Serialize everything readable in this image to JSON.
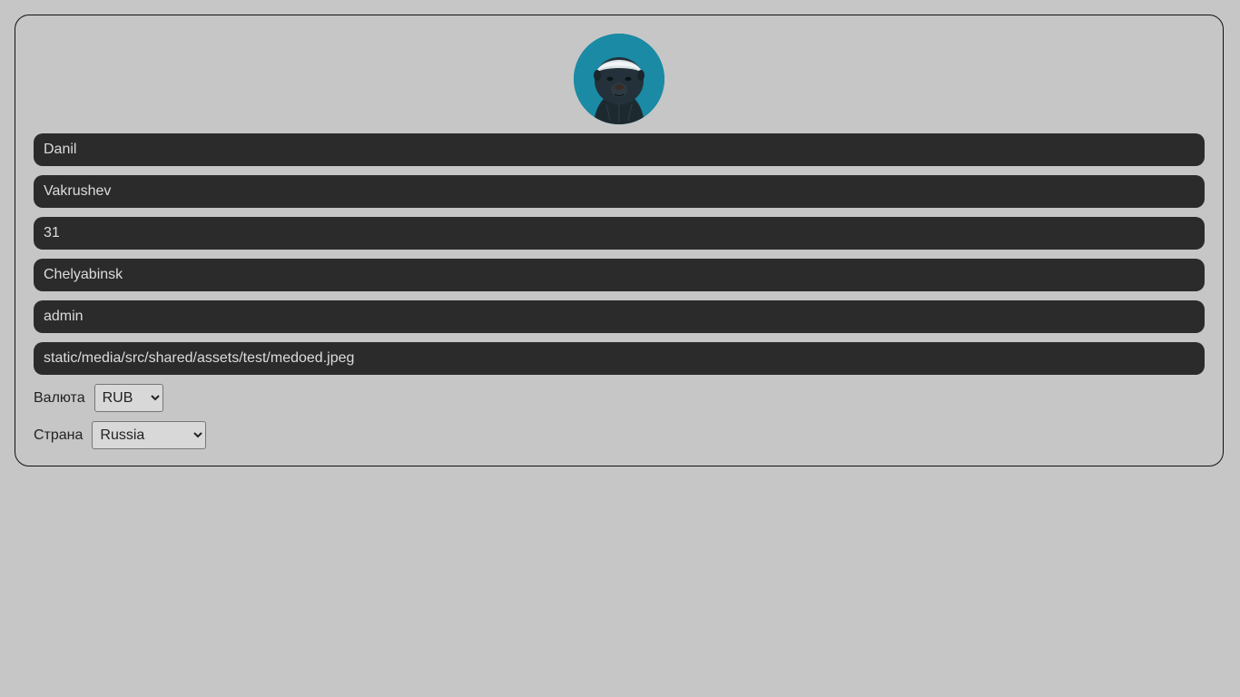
{
  "profile": {
    "avatar_icon": "honey-badger-avatar",
    "fields": [
      {
        "name": "first-name-field",
        "value": "Danil"
      },
      {
        "name": "last-name-field",
        "value": "Vakrushev"
      },
      {
        "name": "age-field",
        "value": "31"
      },
      {
        "name": "city-field",
        "value": "Chelyabinsk"
      },
      {
        "name": "username-field",
        "value": "admin"
      },
      {
        "name": "avatar-path-field",
        "value": "static/media/src/shared/assets/test/medoed.jpeg"
      }
    ],
    "currency": {
      "label": "Валюта",
      "selected": "RUB"
    },
    "country": {
      "label": "Страна",
      "selected": "Russia"
    }
  },
  "colors": {
    "page_bg": "#c6c6c6",
    "field_bg": "#2b2b2b",
    "field_text": "#dcdcdc",
    "avatar_bg": "#1a8aa5"
  }
}
